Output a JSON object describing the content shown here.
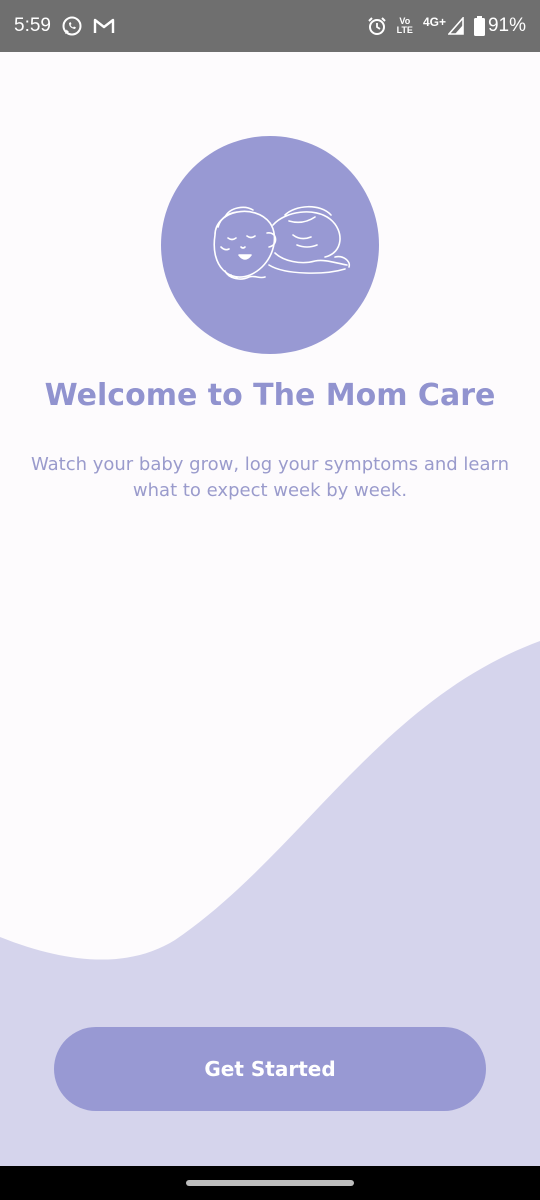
{
  "status_bar": {
    "time": "5:59",
    "network_vo": "Vo",
    "network_lte": "LTE",
    "network_type": "4G+",
    "battery": "91%"
  },
  "welcome": {
    "title": "Welcome to The Mom Care",
    "subtitle": "Watch your baby grow, log your symptoms and learn what to expect week by week.",
    "illustration": "sleeping-baby-icon"
  },
  "actions": {
    "get_started_label": "Get Started"
  },
  "colors": {
    "accent": "#9899d3",
    "wave": "#d5d4ec",
    "background": "#fdfbfd",
    "status_bar": "#6f6f6f"
  }
}
